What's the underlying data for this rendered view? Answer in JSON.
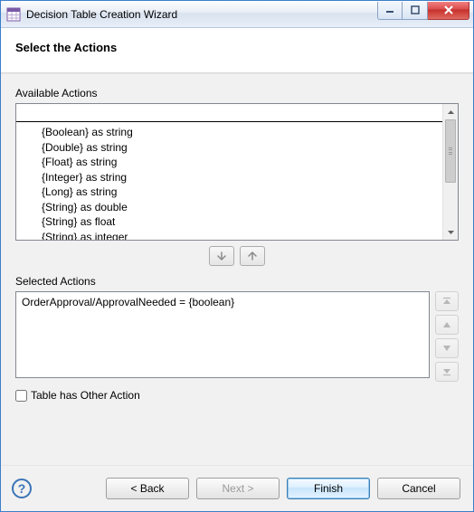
{
  "window": {
    "title": "Decision Table Creation Wizard"
  },
  "banner": {
    "heading": "Select the Actions"
  },
  "available": {
    "label": "Available Actions",
    "filter_value": "",
    "items": [
      "{Boolean} as string",
      "{Double} as string",
      "{Float} as string",
      "{Integer} as string",
      "{Long} as string",
      "{String} as double",
      "{String} as float",
      "{String} as integer"
    ]
  },
  "selected": {
    "label": "Selected Actions",
    "items": [
      "OrderApproval/ApprovalNeeded = {boolean}"
    ]
  },
  "checkbox": {
    "label": "Table has Other Action",
    "checked": false
  },
  "footer": {
    "back": "< Back",
    "next": "Next >",
    "finish": "Finish",
    "cancel": "Cancel"
  }
}
